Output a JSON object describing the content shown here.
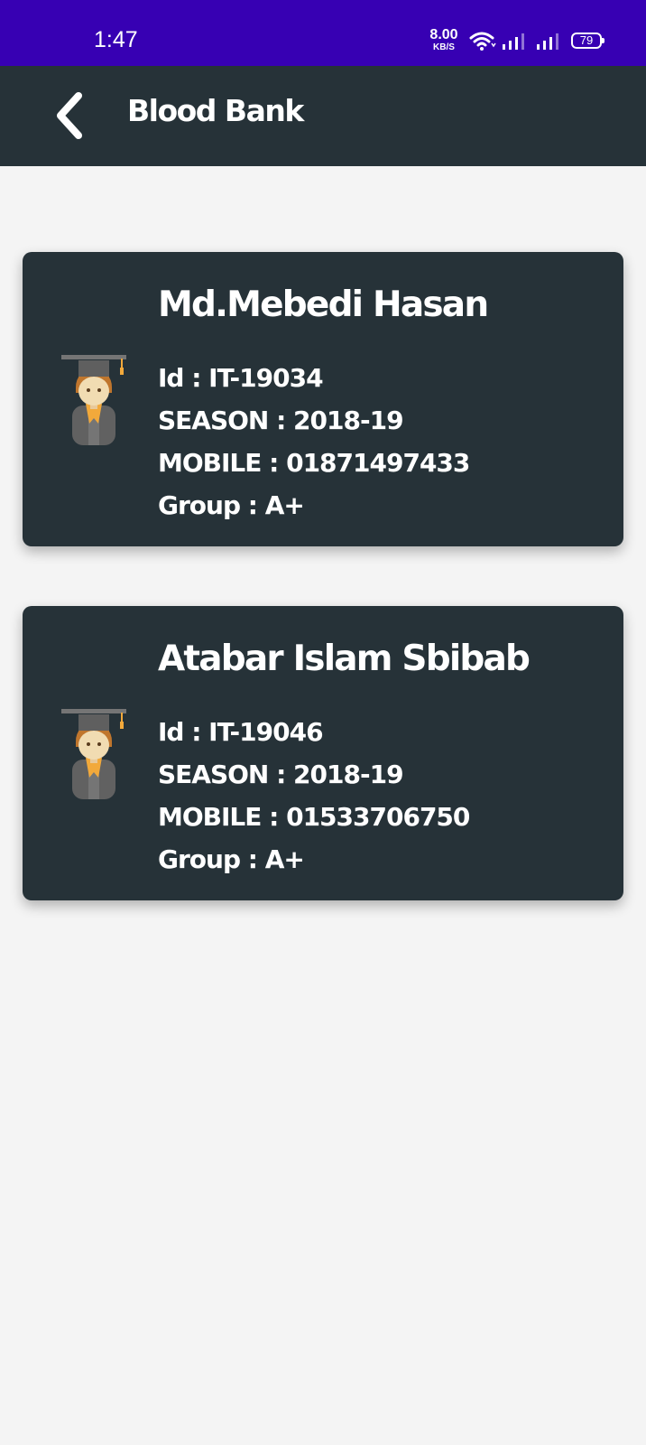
{
  "status_bar": {
    "time": "1:47",
    "net_speed_value": "8.00",
    "net_speed_unit": "KB/S",
    "battery": "79"
  },
  "app_bar": {
    "title": "Blood Bank",
    "back_icon": "chevron-left-icon"
  },
  "donors": [
    {
      "name": "Md.Mebedi Hasan",
      "id_line": "Id : IT-19034",
      "season_line": "SEASON : 2018-19",
      "mobile_line": "MOBILE : 01871497433",
      "group_line": "Group : A+"
    },
    {
      "name": "Atabar Islam Sbibab",
      "id_line": "Id : IT-19046",
      "season_line": "SEASON : 2018-19",
      "mobile_line": "MOBILE : 01533706750",
      "group_line": "Group : A+"
    }
  ],
  "colors": {
    "status_bar": "#3700b3",
    "app_bar": "#263238",
    "card": "#263238",
    "background": "#f4f4f4"
  }
}
